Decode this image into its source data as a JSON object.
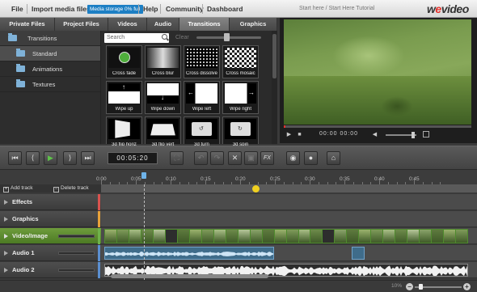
{
  "topbar": {
    "menu": [
      "File",
      "Import media files",
      "Help",
      "Community",
      "Dashboard"
    ],
    "storage_badge": "Media storage 0% full",
    "tutorial": "Start here / Start Here Tutorial",
    "logo_main": "w",
    "logo_e": "e",
    "logo_rest": "video"
  },
  "library": {
    "tabs": [
      "Private Files",
      "Project Files",
      "Videos",
      "Audio",
      "Transitions",
      "Graphics"
    ],
    "active_tab": "Transitions",
    "tree": [
      "Transitions",
      "Standard",
      "Animations",
      "Textures"
    ],
    "search_placeholder": "Search",
    "clear_label": "Clear",
    "transitions": [
      "Cross fade",
      "Cross blur",
      "Cross dissolve",
      "Cross mosaic",
      "Wipe up",
      "Wipe down",
      "Wipe left",
      "Wipe right",
      "3d flip horiz",
      "3d flip vert",
      "3d turn",
      "3d spin"
    ]
  },
  "preview": {
    "time_current": "00:00",
    "time_total": "00:00",
    "icons": [
      "play-icon",
      "stop-icon",
      "volume-icon",
      "fullscreen-icon"
    ]
  },
  "toolbar": {
    "timecode": "00:05:20",
    "fx_label": "FX"
  },
  "timeline": {
    "add_track": "Add track",
    "delete_track": "Delete track",
    "ruler_ticks": [
      "0:00",
      "0:05",
      "0:10",
      "0:15",
      "0:20",
      "0:25",
      "0:30",
      "0:35",
      "0:40",
      "0:45"
    ],
    "tracks": [
      "Effects",
      "Graphics",
      "Video/Image",
      "Audio 1",
      "Audio 2"
    ],
    "track_colors": [
      "#d9534f",
      "#e8a23a",
      "#6fb24a",
      "#5b8fd0",
      "#5b8fd0"
    ],
    "zoom_label": "10%",
    "clip_count": 30
  },
  "colors": {
    "accent_blue": "#1d7fc4",
    "brand_red": "#e5312c",
    "video_green": "#6e9c3c",
    "audio_blue": "#3f6c8a"
  }
}
